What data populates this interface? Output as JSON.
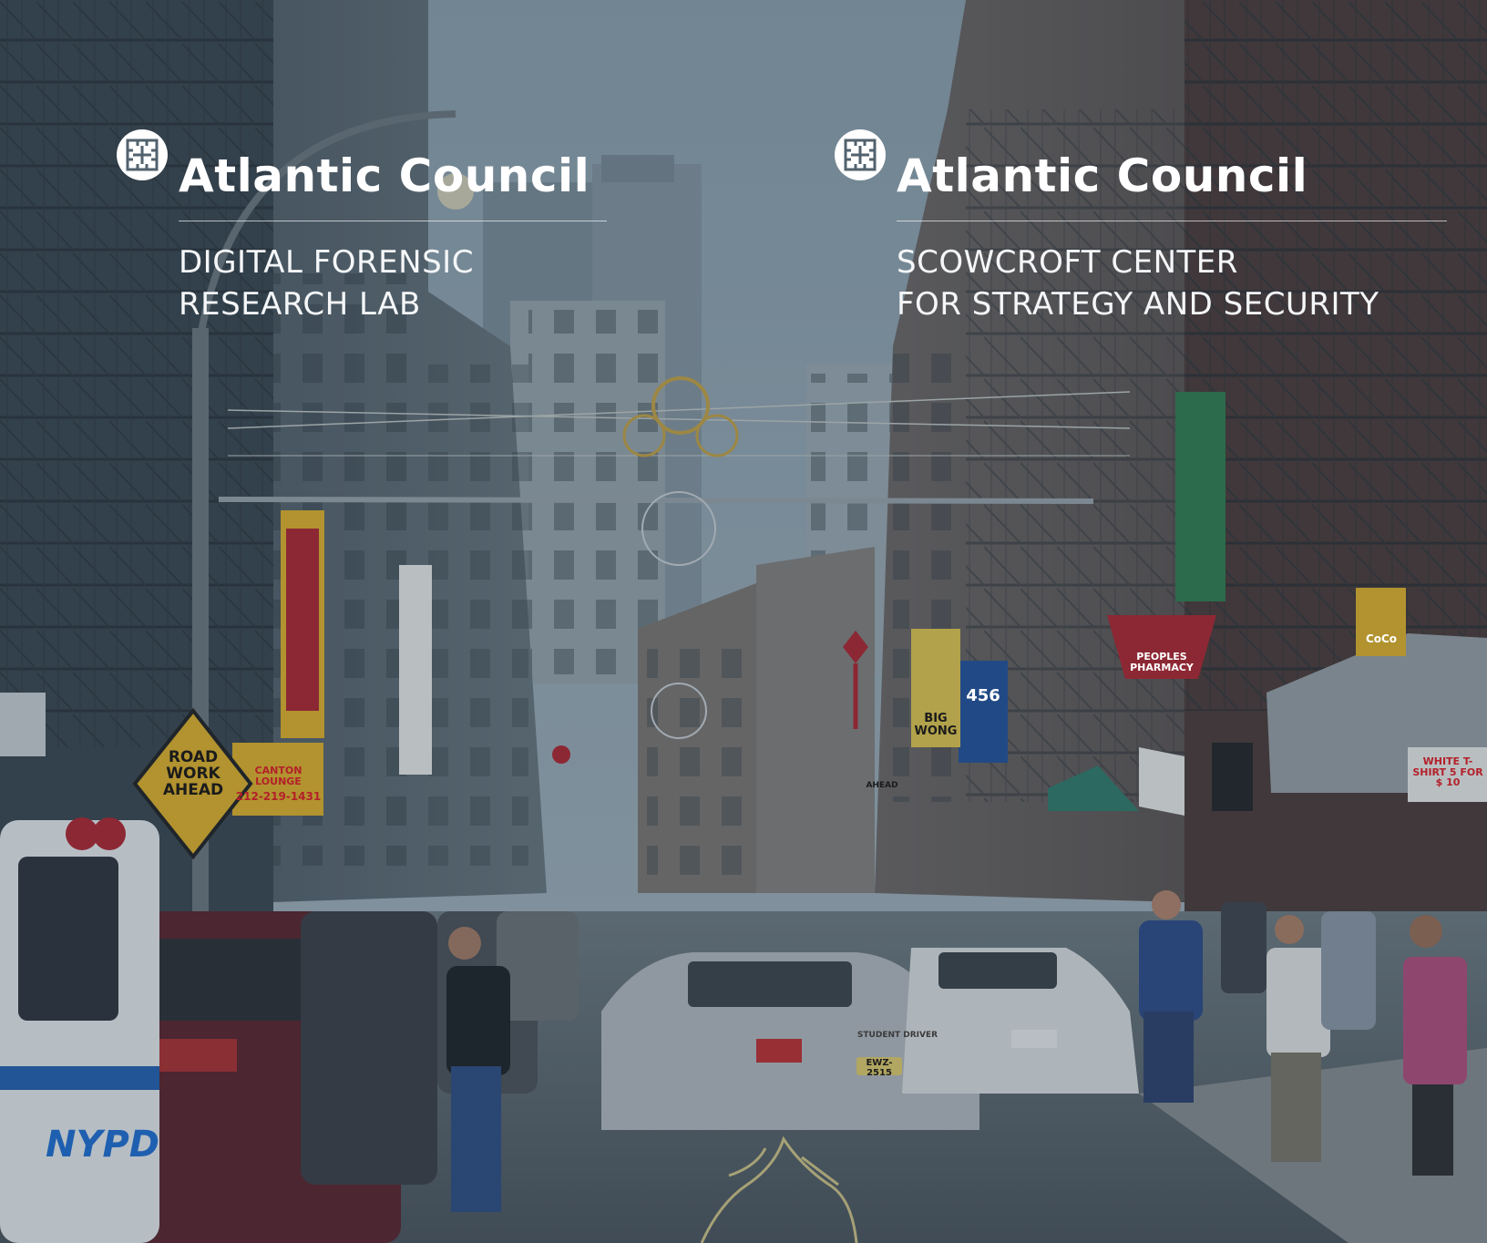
{
  "left_logo": {
    "brand": "Atlantic Council",
    "program_line1": "DIGITAL FORENSIC",
    "program_line2": "RESEARCH LAB"
  },
  "right_logo": {
    "brand": "Atlantic Council",
    "program_line1": "SCOWCROFT CENTER",
    "program_line2": "FOR STRATEGY AND SECURITY"
  },
  "signs": {
    "road_work": "ROAD WORK AHEAD",
    "canton": "CANTON LOUNGE",
    "canton_phone": "212-219-1431",
    "peoples_pharmacy": "PEOPLES PHARMACY",
    "big_wong": "BIG WONG",
    "shang_hai": "456",
    "coco": "CoCo",
    "white_tshirt": "WHITE T-SHIRT 5 FOR $ 10",
    "nypd": "NYPD",
    "plate": "EWZ-2515",
    "student_driver": "STUDENT DRIVER",
    "ahead": "AHEAD"
  },
  "colors": {
    "overlay_text": "#ffffff",
    "sky": "#8fa3b0",
    "sign_yellow": "#e8b423",
    "sign_red": "#b3202a",
    "sign_green": "#2f7d4a"
  }
}
